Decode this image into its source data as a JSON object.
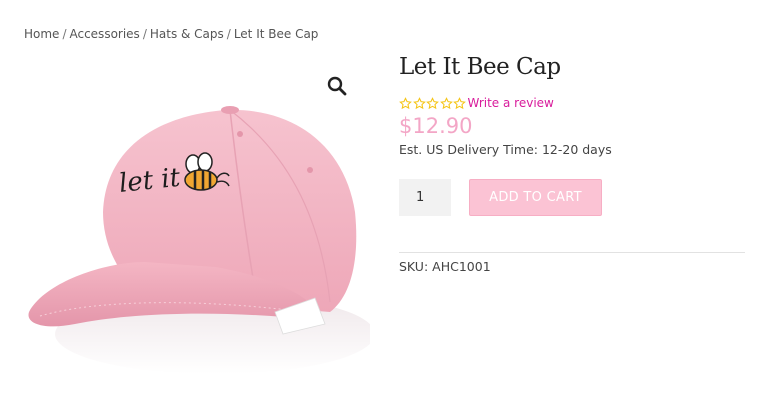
{
  "breadcrumb": {
    "items": [
      "Home",
      "Accessories",
      "Hats & Caps",
      "Let It Bee Cap"
    ],
    "separator": "/"
  },
  "product": {
    "title": "Let It Bee Cap",
    "rating": {
      "stars_filled": 0,
      "stars_total": 5,
      "star_color": "#f5c518"
    },
    "review_link": "Write a review",
    "price": "$12.90",
    "delivery": "Est. US Delivery Time: 12-20 days",
    "quantity": "1",
    "add_to_cart_label": "ADD TO CART",
    "sku_label": "SKU:",
    "sku_value": "AHC1001",
    "image": {
      "alt": "Pink baseball cap embroidered with 'let it' and a bee",
      "embroidery_text": "let it"
    }
  },
  "colors": {
    "accent_pink": "#f3a6c6",
    "button_pink": "#fbc3d4",
    "link_magenta": "#d81b9b"
  },
  "icons": {
    "zoom": "magnifier-icon",
    "star": "star-outline-icon"
  }
}
